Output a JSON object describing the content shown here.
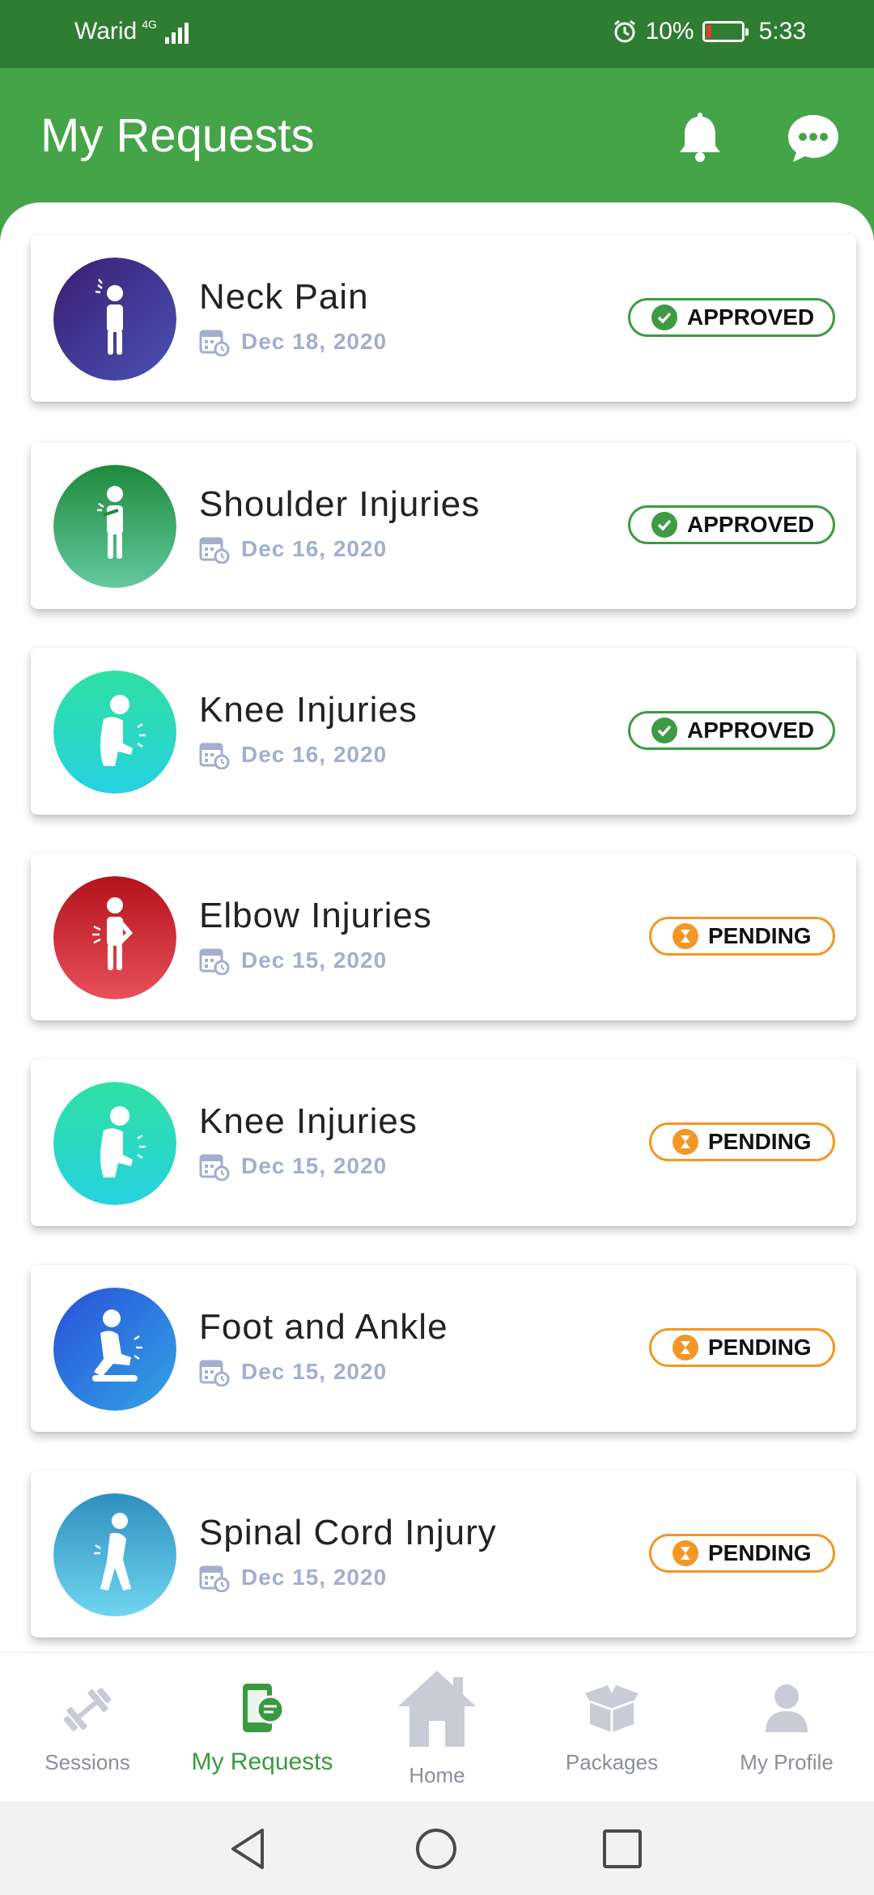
{
  "status_bar": {
    "carrier": "Warid",
    "network": "4G",
    "battery": "10%",
    "time": "5:33"
  },
  "header": {
    "title": "My Requests",
    "icons": [
      "bell-icon",
      "chat-icon"
    ]
  },
  "requests": [
    {
      "title": "Neck Pain",
      "date": "Dec 18, 2020",
      "status": "APPROVED",
      "icon": "neck-pain-icon",
      "color": "#3d3a99"
    },
    {
      "title": "Shoulder Injuries",
      "date": "Dec 16, 2020",
      "status": "APPROVED",
      "icon": "shoulder-injury-icon",
      "color": "#2f9a56"
    },
    {
      "title": "Knee Injuries",
      "date": "Dec 16, 2020",
      "status": "APPROVED",
      "icon": "knee-injury-icon",
      "color": "#2fd6b4"
    },
    {
      "title": "Elbow Injuries",
      "date": "Dec 15, 2020",
      "status": "PENDING",
      "icon": "elbow-injury-icon",
      "color": "#c8232b"
    },
    {
      "title": "Knee Injuries",
      "date": "Dec 15, 2020",
      "status": "PENDING",
      "icon": "knee-injury-icon",
      "color": "#2fd6b4"
    },
    {
      "title": "Foot and Ankle",
      "date": "Dec 15, 2020",
      "status": "PENDING",
      "icon": "foot-ankle-icon",
      "color": "#2d59d6"
    },
    {
      "title": "Spinal Cord Injury",
      "date": "Dec 15, 2020",
      "status": "PENDING",
      "icon": "spinal-cord-icon",
      "color": "#36a3c9"
    }
  ],
  "colors": {
    "header_green": "#45a447",
    "status_green": "#2f7d32",
    "approved": "#3e9b43",
    "pending": "#f29726",
    "date_gray": "#a3aed0"
  },
  "bottom_nav": [
    {
      "label": "Sessions",
      "icon": "dumbbell-icon",
      "active": false
    },
    {
      "label": "My Requests",
      "icon": "requests-icon",
      "active": true
    },
    {
      "label": "Home",
      "icon": "home-icon",
      "active": false
    },
    {
      "label": "Packages",
      "icon": "package-icon",
      "active": false
    },
    {
      "label": "My Profile",
      "icon": "profile-icon",
      "active": false
    }
  ]
}
